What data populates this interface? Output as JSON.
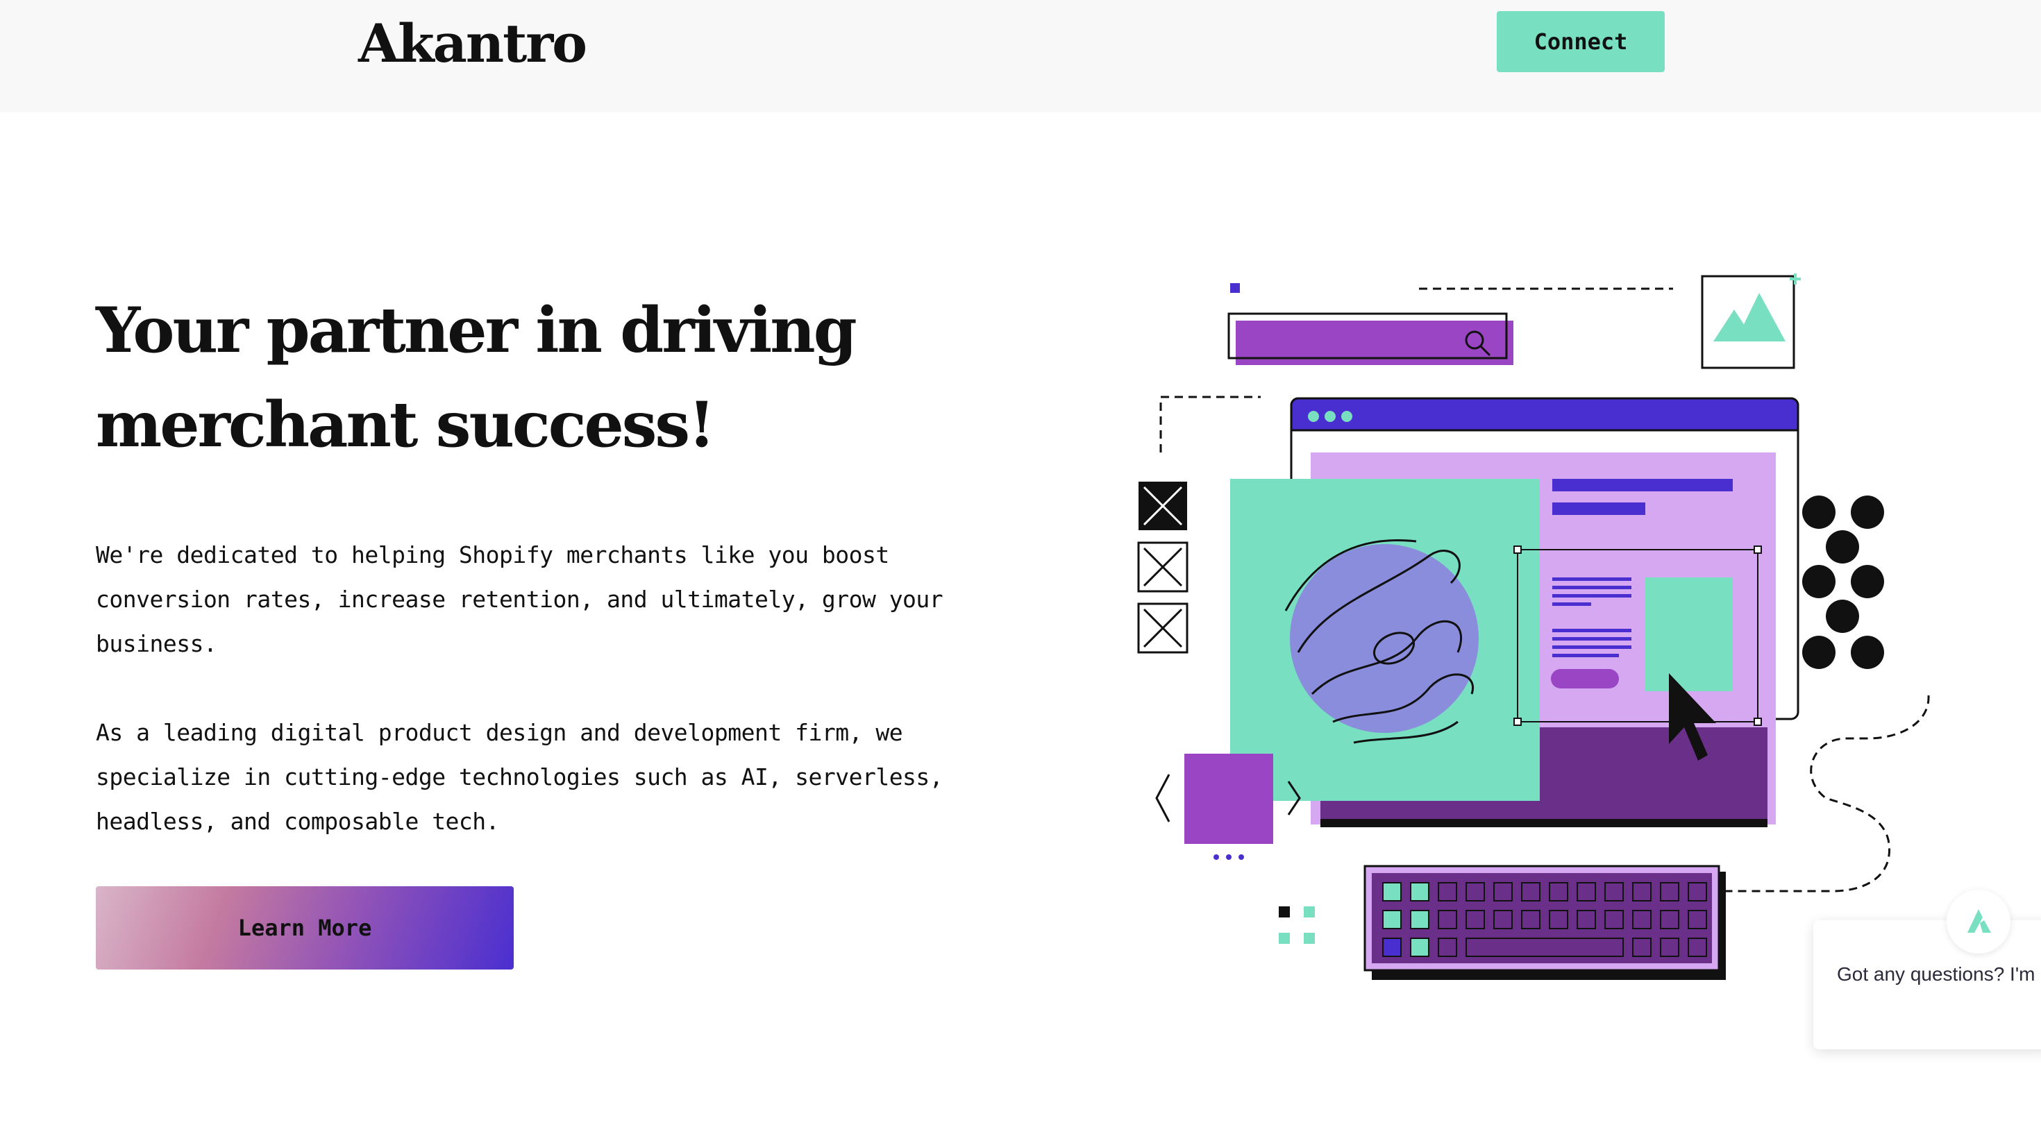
{
  "header": {
    "logo_text": "Akantro",
    "connect_label": "Connect"
  },
  "hero": {
    "title": "Your partner in driving merchant success!",
    "paragraph_1": "We're dedicated to helping Shopify merchants like you boost conversion rates, increase retention, and ultimately, grow your business.",
    "paragraph_2": "As a leading digital product design and development firm, we specialize in cutting-edge technologies such as AI, serverless, headless, and composable tech.",
    "cta_label": "Learn More"
  },
  "chat": {
    "message": "Got any questions? I'm help."
  },
  "colors": {
    "mint": "#78dfc1",
    "purple": "#9a45c4",
    "deep_purple": "#6a3089",
    "indigo": "#4a2fd0",
    "lavender": "#d6a8f2",
    "periwinkle": "#8a8ddc"
  }
}
